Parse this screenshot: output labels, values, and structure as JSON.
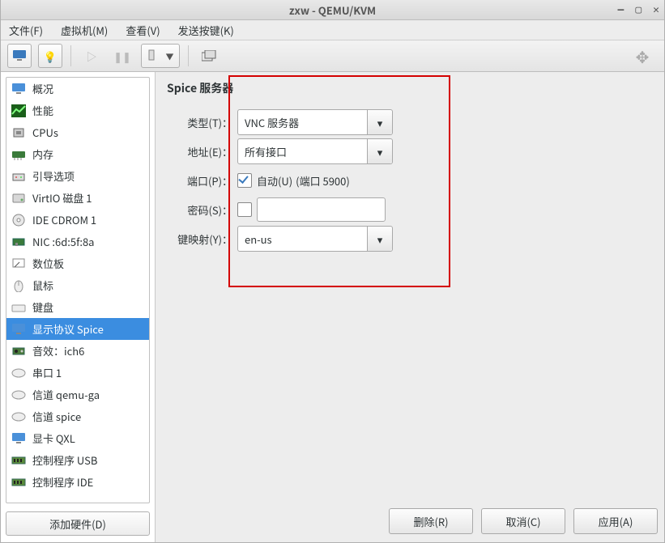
{
  "window": {
    "title": "zxw - QEMU/KVM"
  },
  "menubar": {
    "file": "文件(F)",
    "vm": "虚拟机(M)",
    "view": "查看(V)",
    "sendkey": "发送按键(K)"
  },
  "sidebar": {
    "items": [
      {
        "label": "概况",
        "icon": "monitor"
      },
      {
        "label": "性能",
        "icon": "chart"
      },
      {
        "label": "CPUs",
        "icon": "cpu"
      },
      {
        "label": "内存",
        "icon": "mem"
      },
      {
        "label": "引导选项",
        "icon": "boot"
      },
      {
        "label": "VirtIO 磁盘 1",
        "icon": "disk"
      },
      {
        "label": "IDE CDROM 1",
        "icon": "cd"
      },
      {
        "label": "NIC :6d:5f:8a",
        "icon": "nic"
      },
      {
        "label": "数位板",
        "icon": "tablet"
      },
      {
        "label": "鼠标",
        "icon": "mouse"
      },
      {
        "label": "键盘",
        "icon": "kb"
      },
      {
        "label": "显示协议 Spice",
        "icon": "display",
        "selected": true
      },
      {
        "label": "音效：ich6",
        "icon": "sound"
      },
      {
        "label": "串口 1",
        "icon": "serial"
      },
      {
        "label": "信道 qemu-ga",
        "icon": "channel"
      },
      {
        "label": "信道 spice",
        "icon": "channel"
      },
      {
        "label": "显卡 QXL",
        "icon": "video"
      },
      {
        "label": "控制程序 USB",
        "icon": "ctrl"
      },
      {
        "label": "控制程序 IDE",
        "icon": "ctrl"
      }
    ],
    "add_hardware": "添加硬件(D)"
  },
  "form": {
    "title": "Spice 服务器",
    "type_label": "类型(T)：",
    "type_value": "VNC 服务器",
    "addr_label": "地址(E)：",
    "addr_value": "所有接口",
    "port_label": "端口(P)：",
    "port_auto_label": "自动(U)",
    "port_auto_suffix": "(端口 5900)",
    "port_auto_checked": true,
    "pwd_label": "密码(S)：",
    "pwd_checked": false,
    "pwd_value": "",
    "keymap_label": "键映射(Y)：",
    "keymap_value": "en-us"
  },
  "buttons": {
    "remove": "删除(R)",
    "cancel": "取消(C)",
    "apply": "应用(A)"
  }
}
